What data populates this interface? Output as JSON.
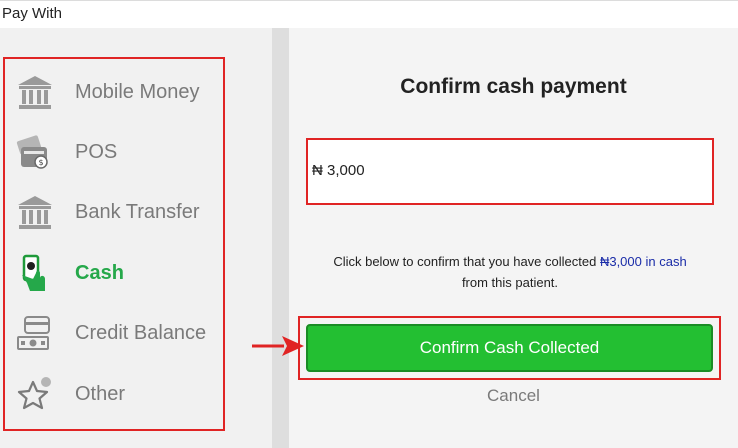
{
  "header": {
    "title": "Pay With"
  },
  "payment_methods": [
    {
      "label": "Mobile Money",
      "icon": "bank-icon",
      "selected": false
    },
    {
      "label": "POS",
      "icon": "pos-card-icon",
      "selected": false
    },
    {
      "label": "Bank Transfer",
      "icon": "bank-icon",
      "selected": false
    },
    {
      "label": "Cash",
      "icon": "cash-hand-icon",
      "selected": true
    },
    {
      "label": "Credit Balance",
      "icon": "credit-card-icon",
      "selected": false
    },
    {
      "label": "Other",
      "icon": "star-icon",
      "selected": false
    }
  ],
  "confirm": {
    "title": "Confirm cash payment",
    "amount_value": "₦ 3,000",
    "instruction_prefix": "Click below to confirm that you have collected ",
    "instruction_highlight": "₦3,000 in cash",
    "instruction_suffix": "from this patient.",
    "confirm_button_label": "Confirm Cash Collected",
    "cancel_label": "Cancel"
  },
  "colors": {
    "accent_green": "#23bf32",
    "selected_text": "#25a84a",
    "highlight_box": "#e02424",
    "link_blue": "#1a2ca8"
  }
}
